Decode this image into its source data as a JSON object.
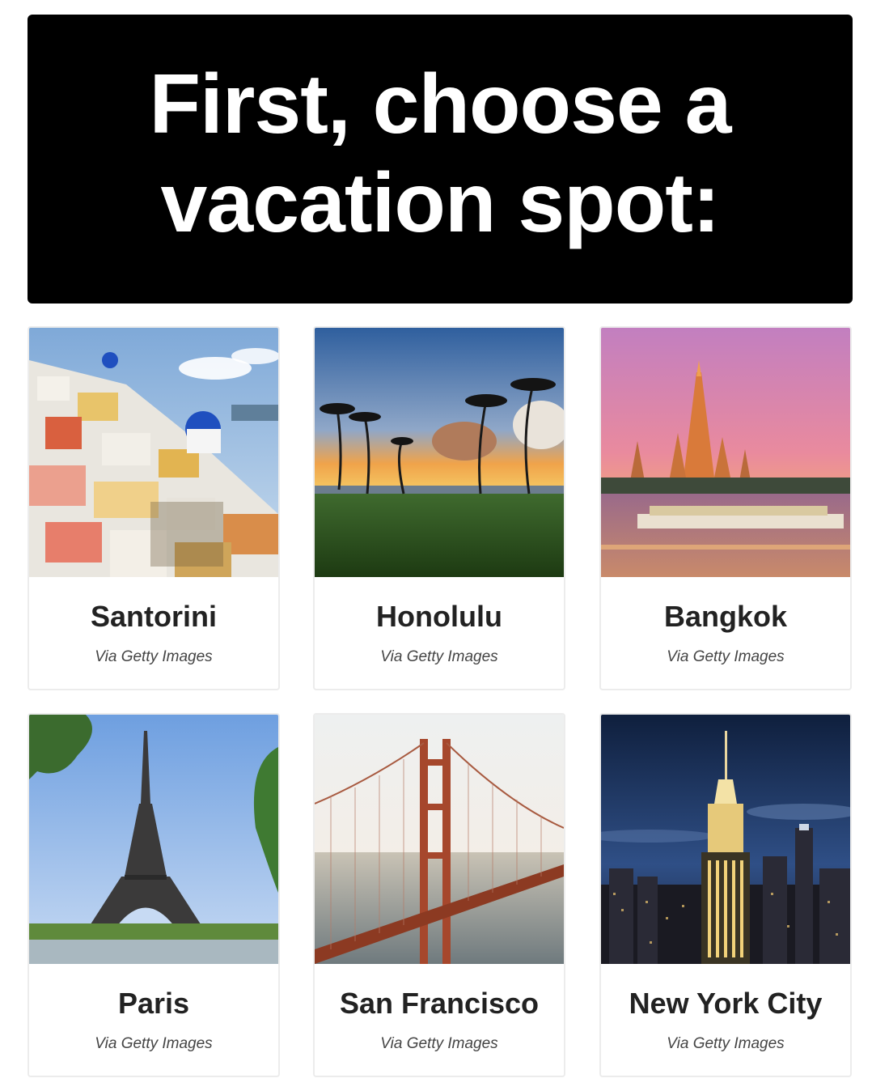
{
  "header": {
    "line1": "First, choose a",
    "line2": "vacation spot:"
  },
  "options": [
    {
      "name": "Santorini",
      "credit": "Via Getty Images"
    },
    {
      "name": "Honolulu",
      "credit": "Via Getty Images"
    },
    {
      "name": "Bangkok",
      "credit": "Via Getty Images"
    },
    {
      "name": "Paris",
      "credit": "Via Getty Images"
    },
    {
      "name": "San Francisco",
      "credit": "Via Getty Images"
    },
    {
      "name": "New York City",
      "credit": "Via Getty Images"
    }
  ]
}
